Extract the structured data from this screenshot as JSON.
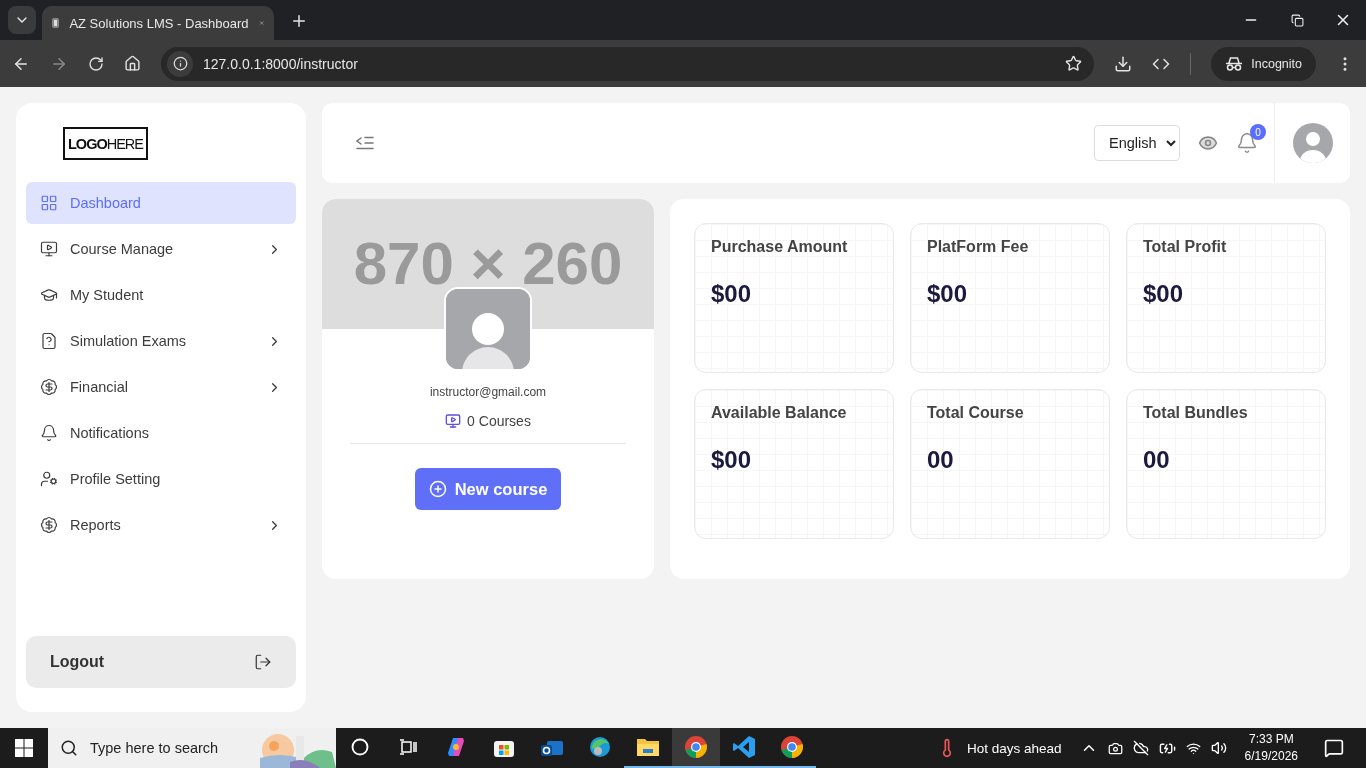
{
  "browser": {
    "tabs": [
      {
        "title": "AZ Solutions LMS - Dashboard",
        "selected": true
      }
    ],
    "url": "127.0.0.1:8000/instructor",
    "profile_label": "Incognito"
  },
  "sidebar": {
    "logo": {
      "bold": "LOGO",
      "light": "HERE"
    },
    "items": [
      {
        "label": "Dashboard",
        "selected": true,
        "submenu": false
      },
      {
        "label": "Course Manage",
        "selected": false,
        "submenu": true
      },
      {
        "label": "My Student",
        "selected": false,
        "submenu": false
      },
      {
        "label": "Simulation Exams",
        "selected": false,
        "submenu": true
      },
      {
        "label": "Financial",
        "selected": false,
        "submenu": true
      },
      {
        "label": "Notifications",
        "selected": false,
        "submenu": false
      },
      {
        "label": "Profile Setting",
        "selected": false,
        "submenu": false
      },
      {
        "label": "Reports",
        "selected": false,
        "submenu": true
      }
    ],
    "logout": "Logout"
  },
  "header": {
    "language": "English",
    "notification_count": "0"
  },
  "profile": {
    "banner_text": "870 × 260",
    "email": "instructor@gmail.com",
    "courses": "0 Courses",
    "button": "New course"
  },
  "stats": [
    {
      "label": "Purchase Amount",
      "value": "$00"
    },
    {
      "label": "PlatForm Fee",
      "value": "$00"
    },
    {
      "label": "Total Profit",
      "value": "$00"
    },
    {
      "label": "Available Balance",
      "value": "$00"
    },
    {
      "label": "Total Course",
      "value": "00"
    },
    {
      "label": "Total Bundles",
      "value": "00"
    }
  ],
  "taskbar": {
    "search_placeholder": "Type here to search",
    "weather": "Hot days ahead",
    "time": "7:33 PM",
    "date": "6/19/2026",
    "apps": [
      {
        "kind": "cortana",
        "active": false,
        "running": false
      },
      {
        "kind": "taskview",
        "active": false,
        "running": false
      },
      {
        "kind": "copilot",
        "active": false,
        "running": false
      },
      {
        "kind": "store",
        "active": false,
        "running": false
      },
      {
        "kind": "outlook",
        "active": false,
        "running": false
      },
      {
        "kind": "edge",
        "active": false,
        "running": false
      },
      {
        "kind": "folder",
        "active": false,
        "running": true
      },
      {
        "kind": "chrome",
        "active": true,
        "running": true
      },
      {
        "kind": "vscode",
        "active": false,
        "running": true
      },
      {
        "kind": "chrome",
        "active": false,
        "running": true
      }
    ]
  }
}
